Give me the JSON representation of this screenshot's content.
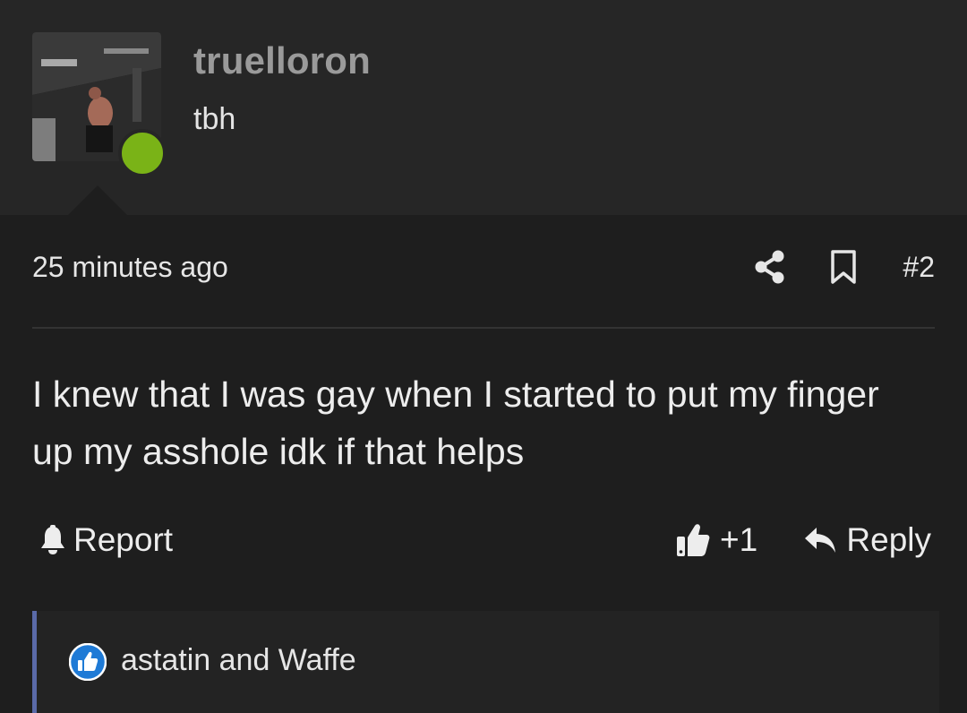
{
  "user": {
    "username": "truelloron",
    "title": "tbh",
    "online_status_color": "#7ab317"
  },
  "post": {
    "timestamp": "25 minutes ago",
    "post_number": "#2",
    "message": "I knew that I was gay when I started to put my finger up my asshole idk if that helps",
    "actions": {
      "report_label": "Report",
      "like_count": "+1",
      "reply_label": "Reply"
    },
    "reactions": {
      "text": "astatin and Waffe",
      "icon": "like-reaction-icon",
      "icon_color": "#1e7ad6"
    }
  },
  "icons": {
    "share": "share-icon",
    "bookmark": "bookmark-icon",
    "report": "bell-icon",
    "like": "thumbs-up-icon",
    "reply": "reply-arrow-icon"
  },
  "colors": {
    "background": "#262626",
    "card": "#1e1e1e",
    "username": "#9a9a9a",
    "reaction_accent": "#5a6aa8"
  }
}
